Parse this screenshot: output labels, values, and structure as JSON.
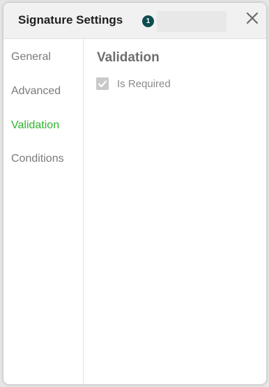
{
  "dialog": {
    "title": "Signature Settings",
    "badge_count": "1",
    "close_icon": "close-icon"
  },
  "sidebar": {
    "items": [
      {
        "label": "General",
        "active": false
      },
      {
        "label": "Advanced",
        "active": false
      },
      {
        "label": "Validation",
        "active": true
      },
      {
        "label": "Conditions",
        "active": false
      }
    ]
  },
  "main": {
    "section_title": "Validation",
    "is_required": {
      "label": "Is Required",
      "checked": true,
      "disabled": true
    }
  },
  "colors": {
    "active_nav": "#2fb42f",
    "badge": "#0f4c4f"
  }
}
